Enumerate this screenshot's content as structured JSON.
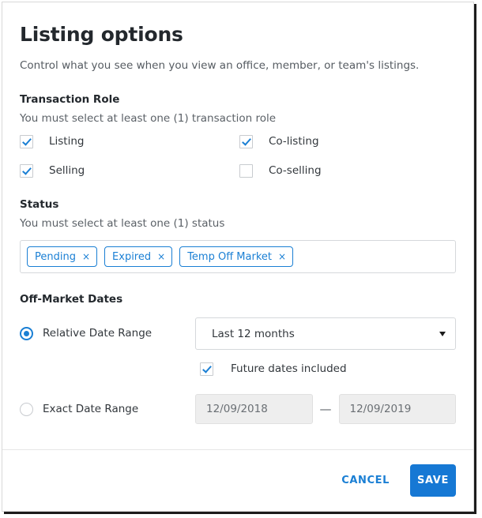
{
  "dialog": {
    "title": "Listing options",
    "subtitle": "Control what you see when you view an office, member, or team's listings."
  },
  "transaction_role": {
    "title": "Transaction Role",
    "hint": "You must select at least one (1) transaction role",
    "options": [
      {
        "label": "Listing",
        "checked": true
      },
      {
        "label": "Co-listing",
        "checked": true
      },
      {
        "label": "Selling",
        "checked": true
      },
      {
        "label": "Co-selling",
        "checked": false
      }
    ]
  },
  "status": {
    "title": "Status",
    "hint": "You must select at least one (1) status",
    "chips": [
      {
        "label": "Pending",
        "remove": "×"
      },
      {
        "label": "Expired",
        "remove": "×"
      },
      {
        "label": "Temp Off Market",
        "remove": "×"
      }
    ]
  },
  "off_market_dates": {
    "title": "Off-Market Dates",
    "relative": {
      "label": "Relative Date Range",
      "selected": true,
      "select_value": "Last 12 months",
      "future_checkbox": {
        "label": "Future dates included",
        "checked": true
      }
    },
    "exact": {
      "label": "Exact Date Range",
      "selected": false,
      "start_date": "12/09/2018",
      "end_date": "12/09/2019",
      "separator": "—"
    }
  },
  "footer": {
    "cancel_label": "CANCEL",
    "save_label": "SAVE"
  },
  "colors": {
    "accent": "#1a7fd4",
    "save_button": "#1678d4",
    "title_text": "#23282d",
    "body_text": "#32373c",
    "hint_text": "#5b6167",
    "border": "#d5d8db",
    "disabled_field": "#eeeeee"
  }
}
